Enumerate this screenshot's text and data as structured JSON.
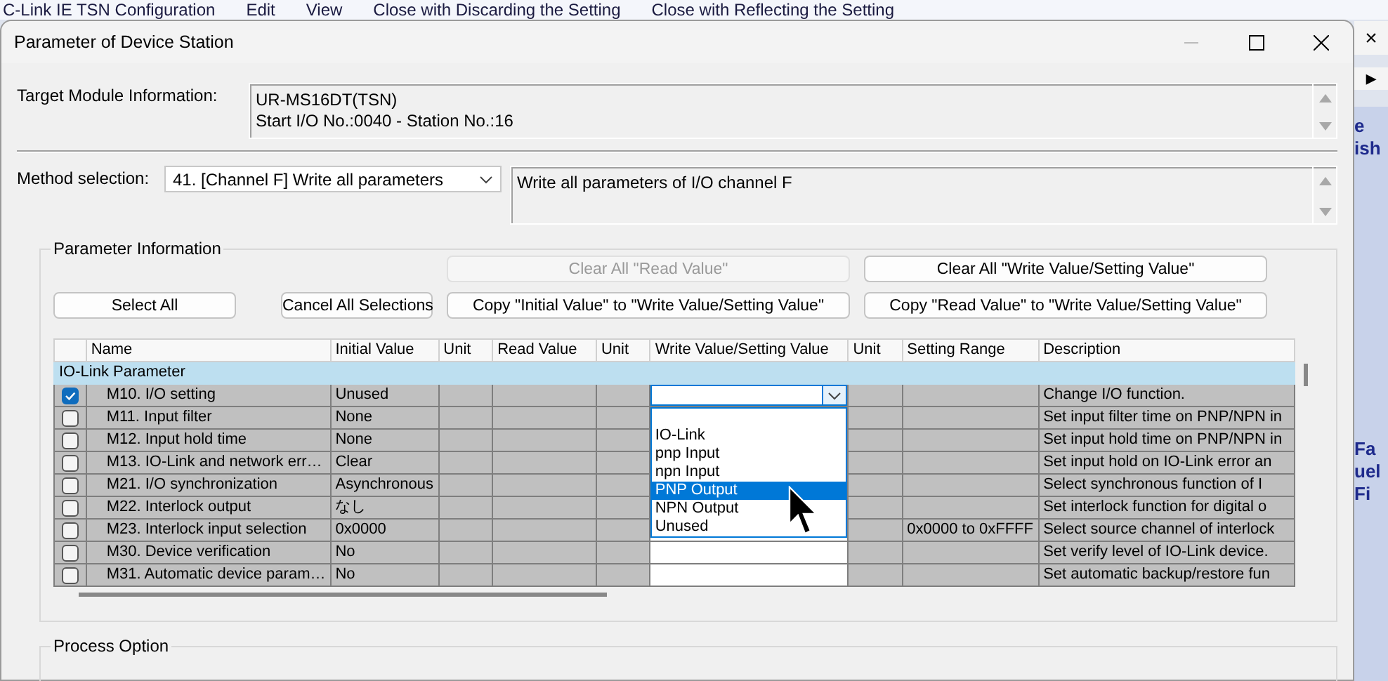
{
  "background_menu": [
    "C-Link IE TSN Configuration",
    "Edit",
    "View",
    "Close with Discarding the Setting",
    "Close with Reflecting the Setting"
  ],
  "background_side": {
    "close": "×",
    "arrow": "▶",
    "fragments_top": [
      "e",
      "ish"
    ],
    "fragments_bottom": [
      "Fa",
      "uel",
      "Fi"
    ]
  },
  "dialog": {
    "title": "Parameter of Device Station"
  },
  "target_module": {
    "label": "Target Module Information:",
    "lines": [
      "UR-MS16DT(TSN)",
      "Start I/O No.:0040 - Station No.:16"
    ]
  },
  "method": {
    "label": "Method selection:",
    "value": "41. [Channel F] Write all parameters",
    "description": "Write all parameters of I/O channel F"
  },
  "parameter_information": {
    "title": "Parameter Information",
    "buttons_row_1": [
      {
        "label": "Clear All \"Read Value\"",
        "disabled": true
      },
      {
        "label": "Clear All \"Write Value/Setting Value\"",
        "disabled": false
      }
    ],
    "buttons_row_2": [
      {
        "label": "Select All",
        "disabled": false
      },
      {
        "label": "Cancel All Selections",
        "disabled": false
      },
      {
        "label": "Copy \"Initial Value\" to \"Write Value/Setting Value\"",
        "disabled": false
      },
      {
        "label": "Copy \"Read Value\" to \"Write Value/Setting Value\"",
        "disabled": false
      }
    ],
    "table": {
      "columns": [
        "Name",
        "Initial Value",
        "Unit",
        "Read Value",
        "Unit",
        "Write Value/Setting Value",
        "Unit",
        "Setting Range",
        "Description"
      ],
      "group": "IO-Link Parameter",
      "rows": [
        {
          "checked": true,
          "name": "M10. I/O setting",
          "initial": "Unused",
          "description": "Change I/O function.",
          "write_dropdown": {
            "options": [
              {
                "label": "IO-Link",
                "selected": false
              },
              {
                "label": "pnp Input",
                "selected": false
              },
              {
                "label": "npn Input",
                "selected": false
              },
              {
                "label": "PNP Output",
                "selected": true
              },
              {
                "label": "NPN Output",
                "selected": false
              },
              {
                "label": "Unused",
                "selected": false
              }
            ]
          }
        },
        {
          "checked": false,
          "name": "M11. Input filter",
          "initial": "None",
          "description": "Set input filter time on PNP/NPN in"
        },
        {
          "checked": false,
          "name": "M12. Input hold time",
          "initial": "None",
          "description": "Set input hold time on PNP/NPN in"
        },
        {
          "checked": false,
          "name": "M13. IO-Link and network err…",
          "initial": "Clear",
          "description": "Set input hold on IO-Link error an"
        },
        {
          "checked": false,
          "name": "M21. I/O synchronization",
          "initial": "Asynchronous",
          "description": "Select synchronous function of I"
        },
        {
          "checked": false,
          "name": "M22. Interlock output",
          "initial": "なし",
          "description": "Set interlock function for digital o"
        },
        {
          "checked": false,
          "name": "M23. Interlock input selection",
          "initial": "0x0000",
          "setting_range": "0x0000 to 0xFFFF",
          "description": "Select source channel of interlock"
        },
        {
          "checked": false,
          "name": "M30. Device verification",
          "initial": "No",
          "description": "Set verify level of IO-Link device."
        },
        {
          "checked": false,
          "name": "M31. Automatic device param…",
          "initial": "No",
          "description": "Set automatic backup/restore fun"
        }
      ]
    }
  },
  "process_option": {
    "title": "Process Option"
  }
}
